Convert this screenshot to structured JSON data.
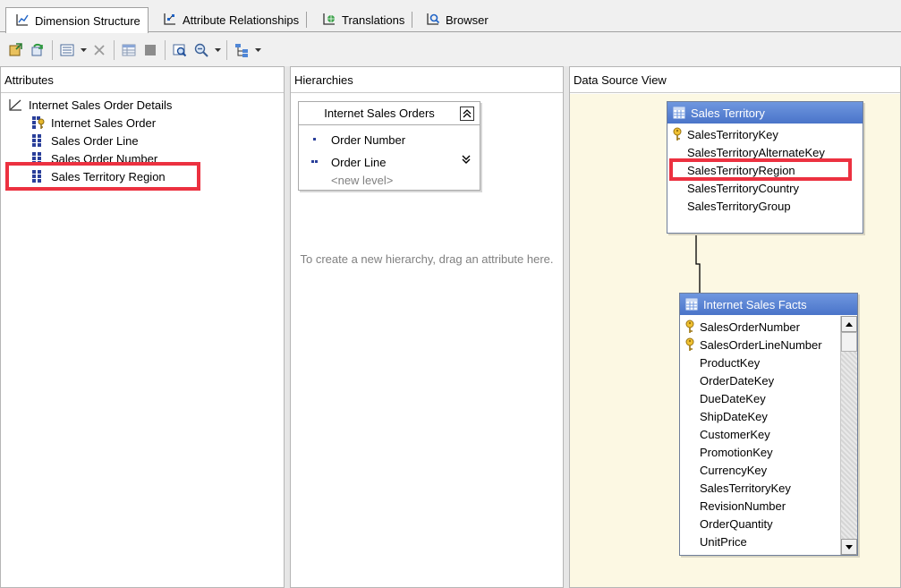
{
  "tabs": [
    {
      "label": "Dimension Structure",
      "icon": "dimension-structure-icon",
      "active": true
    },
    {
      "label": "Attribute Relationships",
      "icon": "attribute-relationships-icon",
      "active": false
    },
    {
      "label": "Translations",
      "icon": "translations-icon",
      "active": false
    },
    {
      "label": "Browser",
      "icon": "browser-icon",
      "active": false
    }
  ],
  "toolbar": {
    "icons": [
      "process-icon",
      "reconnect-icon",
      "view-list-icon",
      "dropdown-arrow-icon",
      "delete-icon",
      "show-table-icon",
      "hide-table-icon",
      "zoom-to-fit-icon",
      "zoom-icon",
      "dropdown-arrow-icon",
      "layout-icon",
      "dropdown-arrow-icon"
    ]
  },
  "attributes": {
    "header": "Attributes",
    "root": "Internet Sales Order Details",
    "items": [
      {
        "label": "Internet Sales Order",
        "icon": "key-attribute-icon"
      },
      {
        "label": "Sales Order Line",
        "icon": "attribute-icon"
      },
      {
        "label": "Sales Order Number",
        "icon": "attribute-icon"
      },
      {
        "label": "Sales Territory Region",
        "icon": "attribute-icon"
      }
    ]
  },
  "hierarchies": {
    "header": "Hierarchies",
    "box": {
      "title": "Internet Sales Orders",
      "levels": [
        "Order Number",
        "Order Line"
      ],
      "new_level": "<new level>"
    },
    "hint": "To create a new hierarchy, drag an attribute here."
  },
  "dsv": {
    "header": "Data Source View",
    "background_color": "#fcf8e3",
    "highlight_color": "#ec3140",
    "sales_territory": {
      "title": "Sales Territory",
      "columns": [
        {
          "name": "SalesTerritoryKey",
          "key": true
        },
        {
          "name": "SalesTerritoryAlternateKey",
          "key": false
        },
        {
          "name": "SalesTerritoryRegion",
          "key": false
        },
        {
          "name": "SalesTerritoryCountry",
          "key": false
        },
        {
          "name": "SalesTerritoryGroup",
          "key": false
        }
      ]
    },
    "internet_sales_facts": {
      "title": "Internet Sales Facts",
      "columns": [
        {
          "name": "SalesOrderNumber",
          "key": true
        },
        {
          "name": "SalesOrderLineNumber",
          "key": true
        },
        {
          "name": "ProductKey",
          "key": false
        },
        {
          "name": "OrderDateKey",
          "key": false
        },
        {
          "name": "DueDateKey",
          "key": false
        },
        {
          "name": "ShipDateKey",
          "key": false
        },
        {
          "name": "CustomerKey",
          "key": false
        },
        {
          "name": "PromotionKey",
          "key": false
        },
        {
          "name": "CurrencyKey",
          "key": false
        },
        {
          "name": "SalesTerritoryKey",
          "key": false
        },
        {
          "name": "RevisionNumber",
          "key": false
        },
        {
          "name": "OrderQuantity",
          "key": false
        },
        {
          "name": "UnitPrice",
          "key": false
        }
      ]
    }
  }
}
